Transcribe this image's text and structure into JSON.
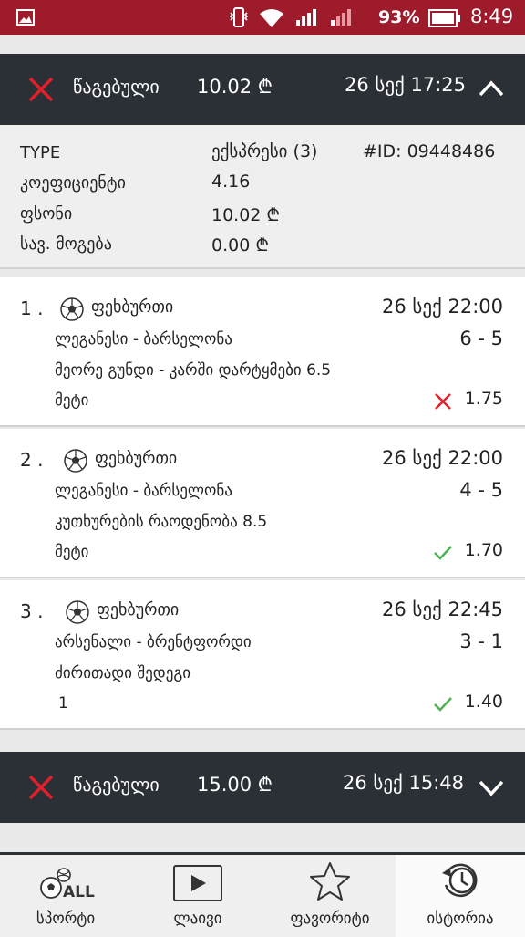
{
  "status_bar": {
    "battery": "93%",
    "time": "8:49",
    "icons": [
      "gallery-icon",
      "vibrate-icon",
      "wifi-icon",
      "signal-icon",
      "signal-icon",
      "battery-icon"
    ]
  },
  "bets": [
    {
      "status": "წაგებული",
      "amount": "10.02 ₾",
      "date": "26 სექ 17:25",
      "expanded": true,
      "details": {
        "type_label": "TYPE",
        "type_value": "ექსპრესი (3)",
        "id": "#ID: 09448486",
        "coef_label": "კოეფიციენტი",
        "coef_value": "4.16",
        "stake_label": "ფსონი",
        "stake_value": "10.02 ₾",
        "winnings_label": "სავ. მოგება",
        "winnings_value": "0.00 ₾"
      },
      "events": [
        {
          "num": "1 .",
          "sport": "ფეხბურთი",
          "time": "26 სექ 22:00",
          "match": "ლეგანესი - ბარსელონა",
          "score": "6 - 5",
          "market": "მეორე გუნდი - კარში დარტყმები 6.5",
          "pick": "მეტი",
          "result": "lost",
          "odd": "1.75"
        },
        {
          "num": "2 .",
          "sport": "ფეხბურთი",
          "time": "26 სექ 22:00",
          "match": "ლეგანესი - ბარსელონა",
          "score": "4 - 5",
          "market": "კუთხურების რაოდენობა 8.5",
          "pick": "მეტი",
          "result": "won",
          "odd": "1.70"
        },
        {
          "num": "3 .",
          "sport": "ფეხბურთი",
          "time": "26 სექ 22:45",
          "match": "არსენალი - ბრენტფორდი",
          "score": "3 - 1",
          "market": "ძირითადი შედეგი",
          "pick": "1",
          "result": "won",
          "odd": "1.40"
        }
      ]
    },
    {
      "status": "წაგებული",
      "amount": "15.00 ₾",
      "date": "26 სექ 15:48",
      "expanded": false
    }
  ],
  "nav": {
    "items": [
      {
        "label": "სპორტი",
        "icon": "sports-all-icon"
      },
      {
        "label": "ლაივი",
        "icon": "play-icon"
      },
      {
        "label": "ფავორიტი",
        "icon": "star-icon"
      },
      {
        "label": "ისტორია",
        "icon": "history-icon"
      }
    ],
    "active": "ისტორია",
    "sports_icon_text": "ALL"
  },
  "colors": {
    "statusbar": "#9e1b2b",
    "header": "#2b2f36",
    "lost": "#e0202a",
    "won": "#4caf50"
  }
}
